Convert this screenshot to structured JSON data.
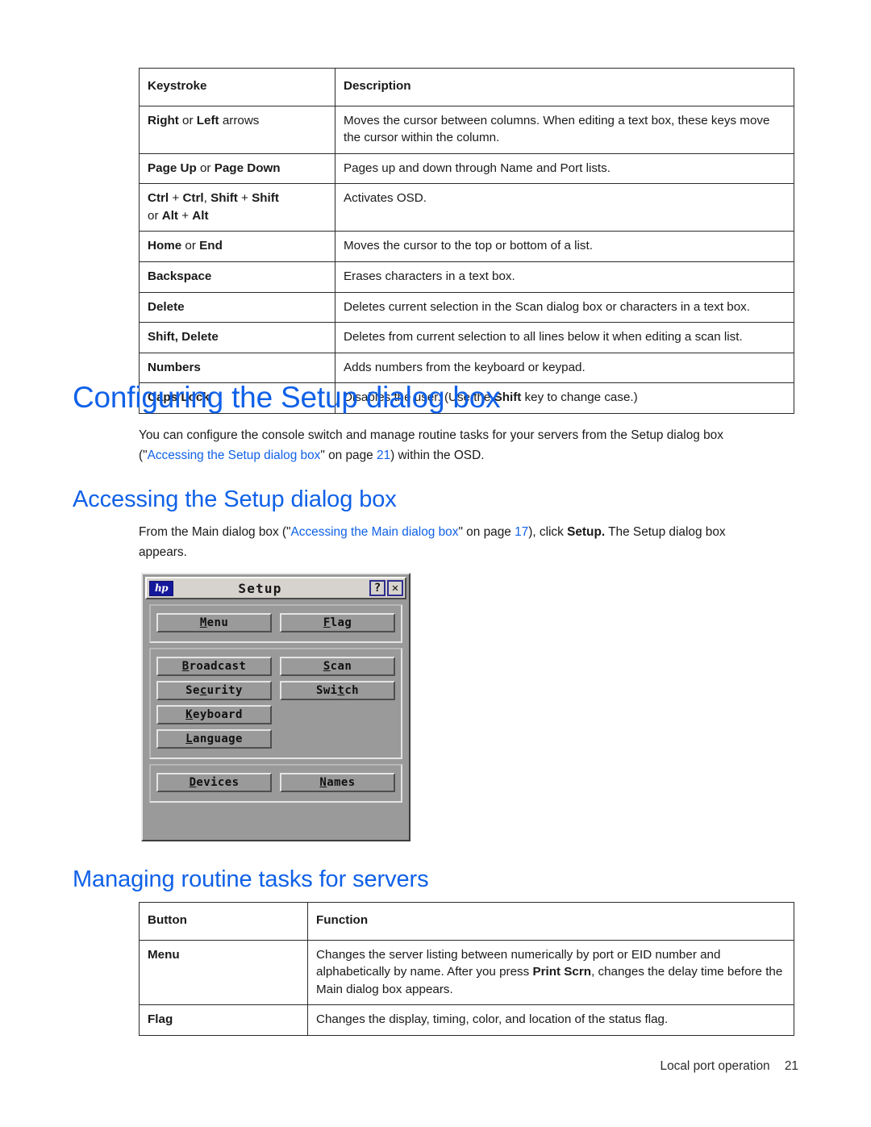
{
  "tables": {
    "keystrokes": {
      "headers": [
        "Keystroke",
        "Description"
      ],
      "rows": [
        {
          "key_html": "<b>Right</b> or <b>Left</b> arrows",
          "desc_html": "Moves the cursor between columns. When editing a text box, these keys move the cursor within the column."
        },
        {
          "key_html": "<b>Page Up</b> or <b>Page Down</b>",
          "desc_html": "Pages up and down through Name and Port lists."
        },
        {
          "key_html": "<b>Ctrl</b> + <b>Ctrl</b>, <b>Shift</b> + <b>Shift</b><br>or <b>Alt</b> + <b>Alt</b>",
          "desc_html": "Activates OSD."
        },
        {
          "key_html": "<b>Home</b> or <b>End</b>",
          "desc_html": "Moves the cursor to the top or bottom of a list."
        },
        {
          "key_html": "<b>Backspace</b>",
          "desc_html": "Erases characters in a text box."
        },
        {
          "key_html": "<b>Delete</b>",
          "desc_html": "Deletes current selection in the Scan dialog box or characters in a text box."
        },
        {
          "key_html": "<b>Shift, Delete</b>",
          "desc_html": "Deletes from current selection to all lines below it when editing a scan list."
        },
        {
          "key_html": "<b>Numbers</b>",
          "desc_html": "Adds numbers from the keyboard or keypad."
        },
        {
          "key_html": "<b>Caps Lock</b>",
          "desc_html": "Disables the user. (Use the <b>Shift</b> key to change case.)"
        }
      ]
    },
    "buttons": {
      "headers": [
        "Button",
        "Function"
      ],
      "rows": [
        {
          "key_html": "<b>Menu</b>",
          "desc_html": "Changes the server listing between numerically by port or EID number and alphabetically by name. After you press <b>Print Scrn</b>, changes the delay time before the Main dialog box appears."
        },
        {
          "key_html": "<b>Flag</b>",
          "desc_html": "Changes the display, timing, color, and location of the status flag."
        }
      ]
    }
  },
  "headings": {
    "configuring": "Configuring the Setup dialog box",
    "accessing": "Accessing the Setup dialog box",
    "managing": "Managing routine tasks for servers"
  },
  "paragraphs": {
    "configuring_html": "You can configure the console switch and manage routine tasks for your servers from the Setup dialog box (\"<a class=\"xref\" href=\"#\" data-name=\"xref-accessing-setup-dialog-box\" data-interactable=\"true\">Accessing the Setup dialog box</a>\" on page <a class=\"xref\" href=\"#\" data-name=\"xref-page-21\" data-interactable=\"true\">21</a>) within the OSD.",
    "accessing_html": "From the Main dialog box (\"<a class=\"xref\" href=\"#\" data-name=\"xref-accessing-main-dialog-box\" data-interactable=\"true\">Accessing the Main dialog box</a>\" on page <a class=\"xref\" href=\"#\" data-name=\"xref-page-17\" data-interactable=\"true\">17</a>), click <b>Setup.</b> The Setup dialog box appears."
  },
  "setup_dialog": {
    "title": "Setup",
    "logo_text": "hp",
    "help_button": "?",
    "close_button": "✕",
    "groups": [
      {
        "name": "group-1",
        "left": [
          {
            "label": "Menu",
            "mnemonic_index": 0
          }
        ],
        "right": [
          {
            "label": "Flag",
            "mnemonic_index": 0
          }
        ]
      },
      {
        "name": "group-2",
        "left": [
          {
            "label": "Broadcast",
            "mnemonic_index": 0
          },
          {
            "label": "Security",
            "mnemonic_index": 2
          },
          {
            "label": "Keyboard",
            "mnemonic_index": 0
          },
          {
            "label": "Language",
            "mnemonic_index": 0
          }
        ],
        "right": [
          {
            "label": "Scan",
            "mnemonic_index": 0
          },
          {
            "label": "Switch",
            "mnemonic_index": 3
          }
        ]
      },
      {
        "name": "group-3",
        "left": [
          {
            "label": "Devices",
            "mnemonic_index": 0
          }
        ],
        "right": [
          {
            "label": "Names",
            "mnemonic_index": 0
          }
        ]
      }
    ]
  },
  "footer": {
    "section": "Local port operation",
    "page_number": "21"
  },
  "colors": {
    "heading_blue": "#1061e8",
    "link_blue": "#1061e8",
    "body_text": "#1a1a1a",
    "table_border": "#2b2b2b",
    "dialog_face": "#9a9a9a",
    "titlebar_face": "#d6d2cd",
    "hp_logo_blue": "#16189b"
  }
}
